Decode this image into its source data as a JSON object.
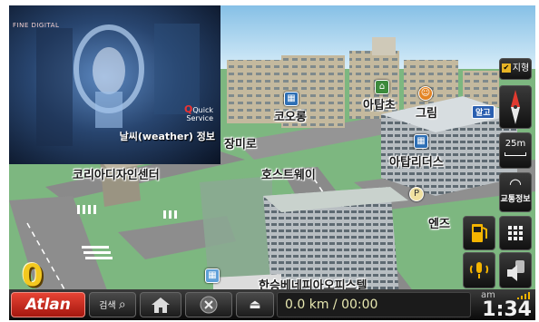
{
  "brand": "Atlan",
  "video": {
    "channel_logo": "FINE DIGITAL",
    "service_line1": "Quick",
    "service_line2": "Service",
    "caption": "날씨(weather) 정보"
  },
  "map_labels": {
    "kolon": "코오롱",
    "atapcho": "아탑초",
    "green": "그림",
    "jangmiro": "장미로",
    "hostway": "호스트웨이",
    "korea_design_center": "코리아디자인센터",
    "atap_leaders": "아탑리더스",
    "entz": "엔즈",
    "hanseung": "한승베네피아오피스텔",
    "tag_bus": "알고"
  },
  "controls": {
    "terrain_label": "지형",
    "scale_label": "25m",
    "traffic_label": "교통정보"
  },
  "speed": "0",
  "bottom": {
    "search_label": "검색",
    "distance_time": "0.0 km / 00:00",
    "ampm": "am",
    "time": "1:34"
  },
  "colors": {
    "brand_red": "#c8261a",
    "accent_yellow": "#f3c820"
  }
}
